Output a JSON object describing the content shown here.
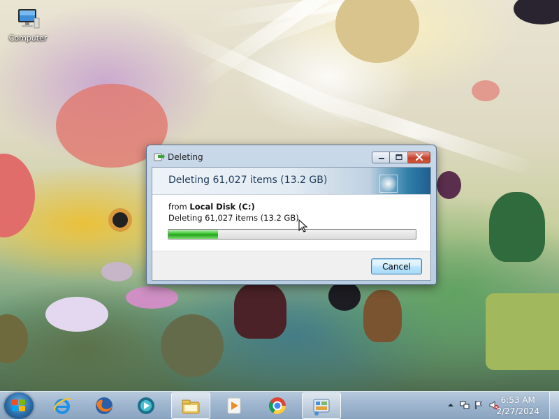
{
  "desktop": {
    "icons": [
      {
        "label": "Computer",
        "icon": "computer-icon"
      }
    ]
  },
  "dialog": {
    "title": "Deleting",
    "header": "Deleting 61,027 items (13.2 GB)",
    "from_prefix": "from",
    "from_location": "Local Disk (C:)",
    "detail": "Deleting 61,027 items (13.2 GB)",
    "progress_fraction": 0.2,
    "cancel_label": "Cancel",
    "window_buttons": [
      "minimize-icon",
      "maximize-icon",
      "close-icon"
    ]
  },
  "taskbar": {
    "start_icon": "windows-start-icon",
    "pinned": [
      {
        "name": "internet-explorer-icon",
        "active": false
      },
      {
        "name": "firefox-icon",
        "active": false
      },
      {
        "name": "media-player-icon",
        "active": false
      },
      {
        "name": "windows-explorer-icon",
        "active": true
      },
      {
        "name": "video-player-icon",
        "active": false
      },
      {
        "name": "chrome-icon",
        "active": false
      },
      {
        "name": "control-panel-icon",
        "active": true
      }
    ],
    "tray_icons": [
      "show-hidden-icons-chevron",
      "network-icon",
      "action-center-flag-icon",
      "volume-muted-icon"
    ],
    "time": "6:53 AM",
    "date": "2/27/2024"
  },
  "colors": {
    "progress_green": "#37c22d",
    "dialog_header_text": "#1c3a59",
    "close_button_red": "#c7402c"
  }
}
